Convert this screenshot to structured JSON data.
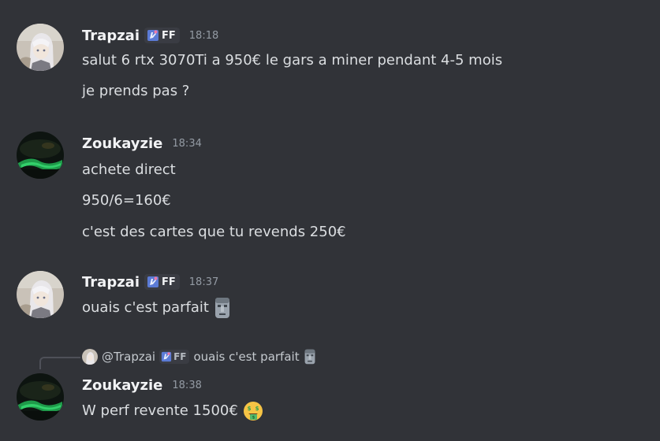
{
  "messages": [
    {
      "author": "Trapzai",
      "tag": "FF",
      "time": "18:18",
      "lines": [
        "salut 6 rtx 3070Ti a 950€ le gars a miner pendant 4-5 mois",
        "je prends pas ?"
      ]
    },
    {
      "author": "Zoukayzie",
      "time": "18:34",
      "lines": [
        "achete direct",
        "950/6=160€",
        "c'est des cartes que tu revends 250€"
      ]
    },
    {
      "author": "Trapzai",
      "tag": "FF",
      "time": "18:37",
      "lines": [
        "ouais c'est parfait"
      ],
      "emoji": "moai-emoji"
    },
    {
      "author": "Zoukayzie",
      "time": "18:38",
      "reply": {
        "mention": "@Trapzai",
        "tag": "FF",
        "text": "ouais c'est parfait",
        "emoji": "moai-emoji"
      },
      "lines": [
        "W perf revente 1500€"
      ],
      "emoji": "money-mouth-face-emoji"
    }
  ],
  "colors": {
    "background": "#313338",
    "username": "#f2f3f5",
    "text": "#dbdee1",
    "timestamp": "#949ba4",
    "tag_bg": "#3a3c43"
  }
}
